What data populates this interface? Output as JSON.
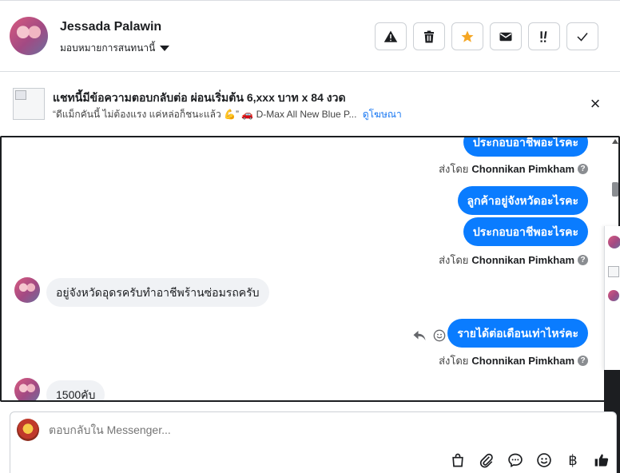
{
  "header": {
    "name": "Jessada Palawin",
    "assign_label": "มอบหมายการสนทนานี้",
    "toolbar": [
      {
        "name": "spam-button",
        "icon": "warning-icon",
        "glyph": "⚠"
      },
      {
        "name": "delete-button",
        "icon": "trash-icon",
        "glyph": "🗑"
      },
      {
        "name": "star-button",
        "icon": "star-icon",
        "glyph": "★",
        "color": "#f5a623"
      },
      {
        "name": "mark-unread-button",
        "icon": "envelope-icon",
        "glyph": "✉"
      },
      {
        "name": "follow-up-button",
        "icon": "exclamation-icon",
        "glyph": "!!"
      },
      {
        "name": "done-button",
        "icon": "check-icon",
        "glyph": "✓"
      }
    ]
  },
  "banner": {
    "title": "แชทนี้มีข้อความตอบกลับต่อ ผ่อนเริ่มต้น 6,xxx บาท x 84 งวด",
    "subtitle": "“ดีแม็กคันนี้ ไม่ต้องแรง แค่หล่อก็ชนะแล้ว 💪” 🚗 D-Max All New Blue P...",
    "link": "ดูโฆษณา"
  },
  "chat": {
    "messages": [
      {
        "dir": "out",
        "text": "ประกอบอาชีพอะไรคะ"
      },
      {
        "dir": "meta",
        "prefix": "ส่งโดย",
        "agent": "Chonnikan Pimkham"
      },
      {
        "dir": "out",
        "text": "ลูกค้าอยู่จังหวัดอะไรคะ"
      },
      {
        "dir": "out",
        "text": "ประกอบอาชีพอะไรคะ"
      },
      {
        "dir": "meta",
        "prefix": "ส่งโดย",
        "agent": "Chonnikan Pimkham"
      },
      {
        "dir": "in",
        "text": "อยู่จังหวัดอุดรครับทำอาชีพร้านซ่อมรถครับ"
      },
      {
        "dir": "out",
        "text": "รายได้ต่อเดือนเท่าไหร่คะ"
      },
      {
        "dir": "meta",
        "prefix": "ส่งโดย",
        "agent": "Chonnikan Pimkham"
      },
      {
        "dir": "in",
        "text": "1500คับ"
      }
    ],
    "accent": "#0a7cff"
  },
  "composer": {
    "placeholder": "ตอบกลับใน Messenger...",
    "tools": [
      "shopping-bag-icon",
      "paperclip-icon",
      "chat-bubble-icon",
      "emoji-icon",
      "baht-icon",
      "thumbs-up-icon"
    ],
    "baht_glyph": "฿"
  }
}
